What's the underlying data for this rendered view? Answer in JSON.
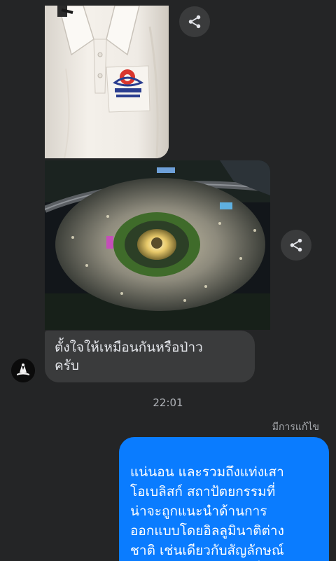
{
  "messages": {
    "received_text": "ตั้งใจให้เหมือนกันหรือป่าว\nครับ",
    "timestamp": "22:01",
    "edited_label": "มีการแก้ไข",
    "sent_text": "แน่นอน และรวมถึงแท่งเสา\nโอเบลิสก์ สถาปัตยกรรมที่\nน่าจะถูกแนะนำด้านการ\nออกแบบโดยอิลลูมินาติต่าง\nชาติ เช่นเดียวกับสัญลักษณ์\nองค์กรการแพทย์ และอื่นๆ"
  },
  "colors": {
    "background": "#242526",
    "received_bubble": "#3a3b3c",
    "sent_bubble": "#0a7cff",
    "share_button": "#3a3b3c"
  },
  "icons": {
    "share": "share-icon"
  }
}
